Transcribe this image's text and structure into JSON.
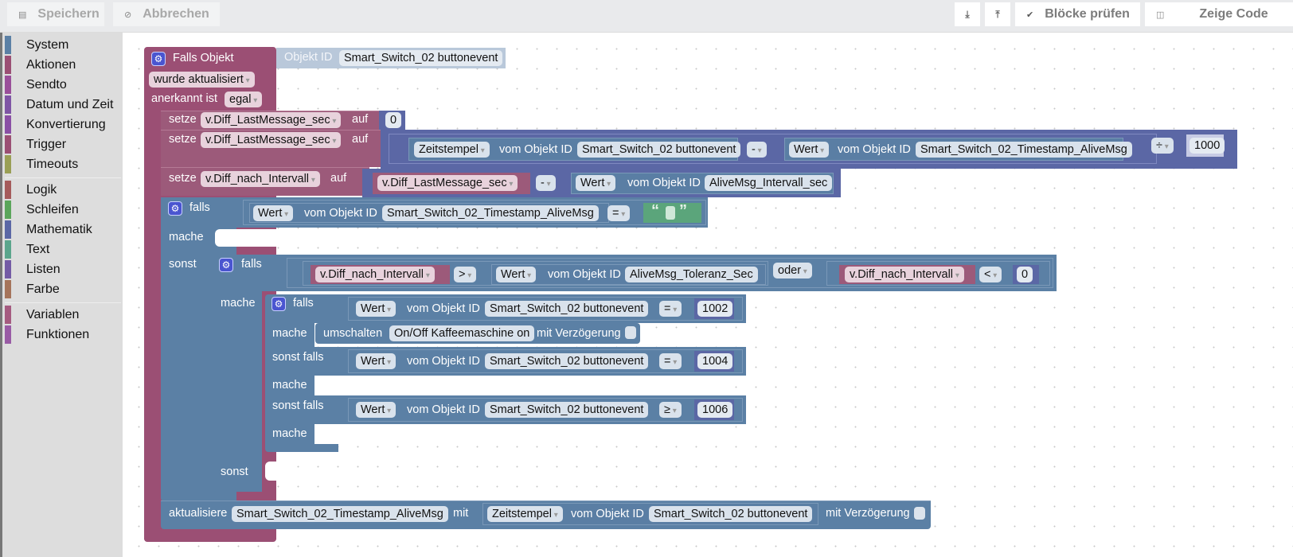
{
  "toolbar": {
    "save_label": "Speichern",
    "save_icon": "save-icon",
    "cancel_label": "Abbrechen",
    "cancel_icon": "cancel-icon",
    "export_icon": "export-icon",
    "import_icon": "import-icon",
    "check_label": "Blöcke prüfen",
    "check_icon": "checkmark-icon",
    "code_label": "Zeige Code",
    "code_icon": "code-icon"
  },
  "sidebar": {
    "groups": [
      [
        {
          "label": "System",
          "color": "#5b80a5"
        },
        {
          "label": "Aktionen",
          "color": "#9b4f74"
        },
        {
          "label": "Sendto",
          "color": "#9a4f9a"
        },
        {
          "label": "Datum und Zeit",
          "color": "#7f55a5"
        },
        {
          "label": "Konvertierung",
          "color": "#8a4fa5"
        },
        {
          "label": "Trigger",
          "color": "#9b4f74"
        },
        {
          "label": "Timeouts",
          "color": "#9a9f55"
        }
      ],
      [
        {
          "label": "Logik",
          "color": "#a55b5b"
        },
        {
          "label": "Schleifen",
          "color": "#5ba55b"
        },
        {
          "label": "Mathematik",
          "color": "#5b67a5"
        },
        {
          "label": "Text",
          "color": "#5ba58c"
        },
        {
          "label": "Listen",
          "color": "#745ba5"
        },
        {
          "label": "Farbe",
          "color": "#a5745b"
        }
      ],
      [
        {
          "label": "Variablen",
          "color": "#a55b80"
        },
        {
          "label": "Funktionen",
          "color": "#995ba5"
        }
      ]
    ]
  },
  "workspace": {
    "trigger": {
      "title": "Falls Objekt",
      "object_id_label": "Objekt ID",
      "object_id": "Smart_Switch_02 buttonevent",
      "condition": "wurde aktualisiert",
      "ack_label": "anerkannt ist",
      "ack_value": "egal"
    },
    "set1": {
      "label": "setze",
      "var": "v.Diff_LastMessage_sec",
      "to": "auf",
      "value": "0"
    },
    "set2": {
      "label": "setze",
      "var": "v.Diff_LastMessage_sec",
      "to": "auf",
      "left_prop": "Zeitstempel",
      "of_label": "vom Objekt ID",
      "left_obj": "Smart_Switch_02 buttonevent",
      "op": "-",
      "right_prop": "Wert",
      "right_obj": "Smart_Switch_02_Timestamp_AliveMsg",
      "div_op": "÷",
      "divisor": "1000"
    },
    "set3": {
      "label": "setze",
      "var": "v.Diff_nach_Intervall",
      "to": "auf",
      "left_var": "v.Diff_LastMessage_sec",
      "op": "-",
      "right_prop": "Wert",
      "of_label": "vom Objekt ID",
      "right_obj": "AliveMsg_Intervall_sec"
    },
    "if1": {
      "if_label": "falls",
      "do_label": "mache",
      "else_label": "sonst",
      "prop": "Wert",
      "of_label": "vom Objekt ID",
      "obj": "Smart_Switch_02_Timestamp_AliveMsg",
      "op": "=",
      "open_quote": "“",
      "close_quote": "”"
    },
    "if2": {
      "if_label": "falls",
      "do_label": "mache",
      "else_label": "sonst",
      "left_var": "v.Diff_nach_Intervall",
      "op1": ">",
      "prop": "Wert",
      "of_label": "vom Objekt ID",
      "obj": "AliveMsg_Toleranz_Sec",
      "logic": "oder",
      "right_var": "v.Diff_nach_Intervall",
      "op2": "<",
      "value": "0"
    },
    "if3": {
      "if_label": "falls",
      "do_label": "mache",
      "elseif_label": "sonst falls",
      "cond1": {
        "prop": "Wert",
        "of_label": "vom Objekt ID",
        "obj": "Smart_Switch_02 buttonevent",
        "op": "=",
        "value": "1002"
      },
      "action": {
        "label": "umschalten",
        "obj": "On/Off Kaffeemaschine on",
        "delay_label": "mit Verzögerung"
      },
      "cond2": {
        "prop": "Wert",
        "of_label": "vom Objekt ID",
        "obj": "Smart_Switch_02 buttonevent",
        "op": "=",
        "value": "1004"
      },
      "cond3": {
        "prop": "Wert",
        "of_label": "vom Objekt ID",
        "obj": "Smart_Switch_02 buttonevent",
        "op": "≥",
        "value": "1006"
      }
    },
    "update": {
      "label": "aktualisiere",
      "obj": "Smart_Switch_02_Timestamp_AliveMsg",
      "with_label": "mit",
      "prop": "Zeitstempel",
      "of_label": "vom Objekt ID",
      "src_obj": "Smart_Switch_02 buttonevent",
      "delay_label": "mit Verzögerung"
    }
  }
}
